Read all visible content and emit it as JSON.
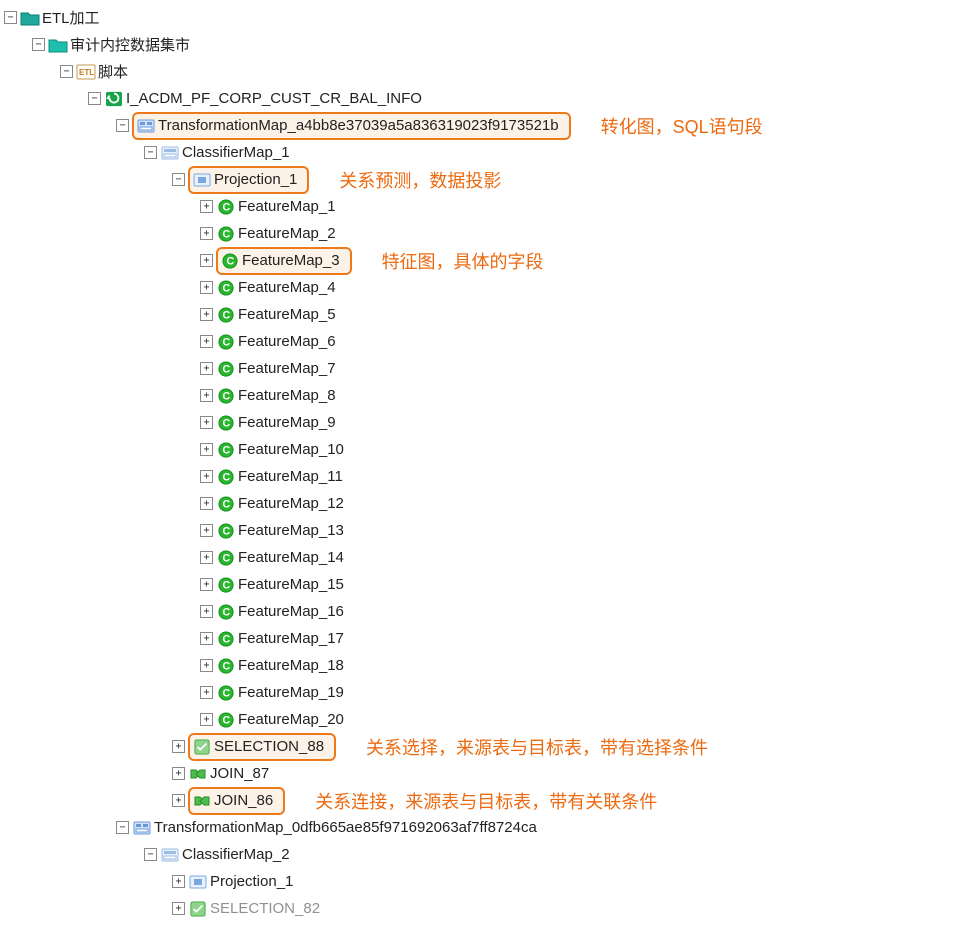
{
  "tree": {
    "root": "ETL加工",
    "node1": "审计内控数据集市",
    "node2": "脚本",
    "node3": "I_ACDM_PF_CORP_CUST_CR_BAL_INFO",
    "tmap1": "TransformationMap_a4bb8e37039a5a836319023f9173521b",
    "tmap1_ann": "转化图，SQL语句段",
    "cmap1": "ClassifierMap_1",
    "proj1": "Projection_1",
    "proj1_ann": "关系预测，数据投影",
    "fm_prefix": "FeatureMap_",
    "fm3_ann": "特征图，具体的字段",
    "sel88": "SELECTION_88",
    "sel88_ann": "关系选择，来源表与目标表，带有选择条件",
    "join87": "JOIN_87",
    "join86": "JOIN_86",
    "join86_ann": "关系连接，来源表与目标表，带有关联条件",
    "tmap2": "TransformationMap_0dfb665ae85f971692063af7ff8724ca",
    "cmap2": "ClassifierMap_2",
    "proj2": "Projection_1",
    "sel82": "SELECTION_82"
  },
  "feature_count": 20
}
